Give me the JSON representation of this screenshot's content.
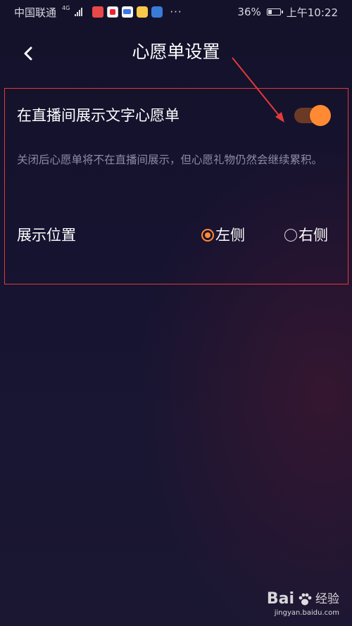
{
  "status_bar": {
    "carrier": "中国联通",
    "network_type": "4G",
    "battery_percent": "36%",
    "battery_level": 0.36,
    "time": "上午10:22",
    "overflow": "···"
  },
  "header": {
    "title": "心愿单设置",
    "back_icon": "chevron-left-icon"
  },
  "wishlist_setting": {
    "title": "在直播间展示文字心愿单",
    "toggle_on": true,
    "description": "关闭后心愿单将不在直播间展示，但心愿礼物仍然会继续累积。"
  },
  "display_position": {
    "label": "展示位置",
    "options": [
      {
        "label": "左侧",
        "selected": true
      },
      {
        "label": "右侧",
        "selected": false
      }
    ]
  },
  "watermark": {
    "brand": "Bai",
    "brand_suffix": "经验",
    "url": "jingyan.baidu.com"
  },
  "colors": {
    "accent": "#ff8a33",
    "annotation": "#e23a3a",
    "background": "#161330"
  }
}
